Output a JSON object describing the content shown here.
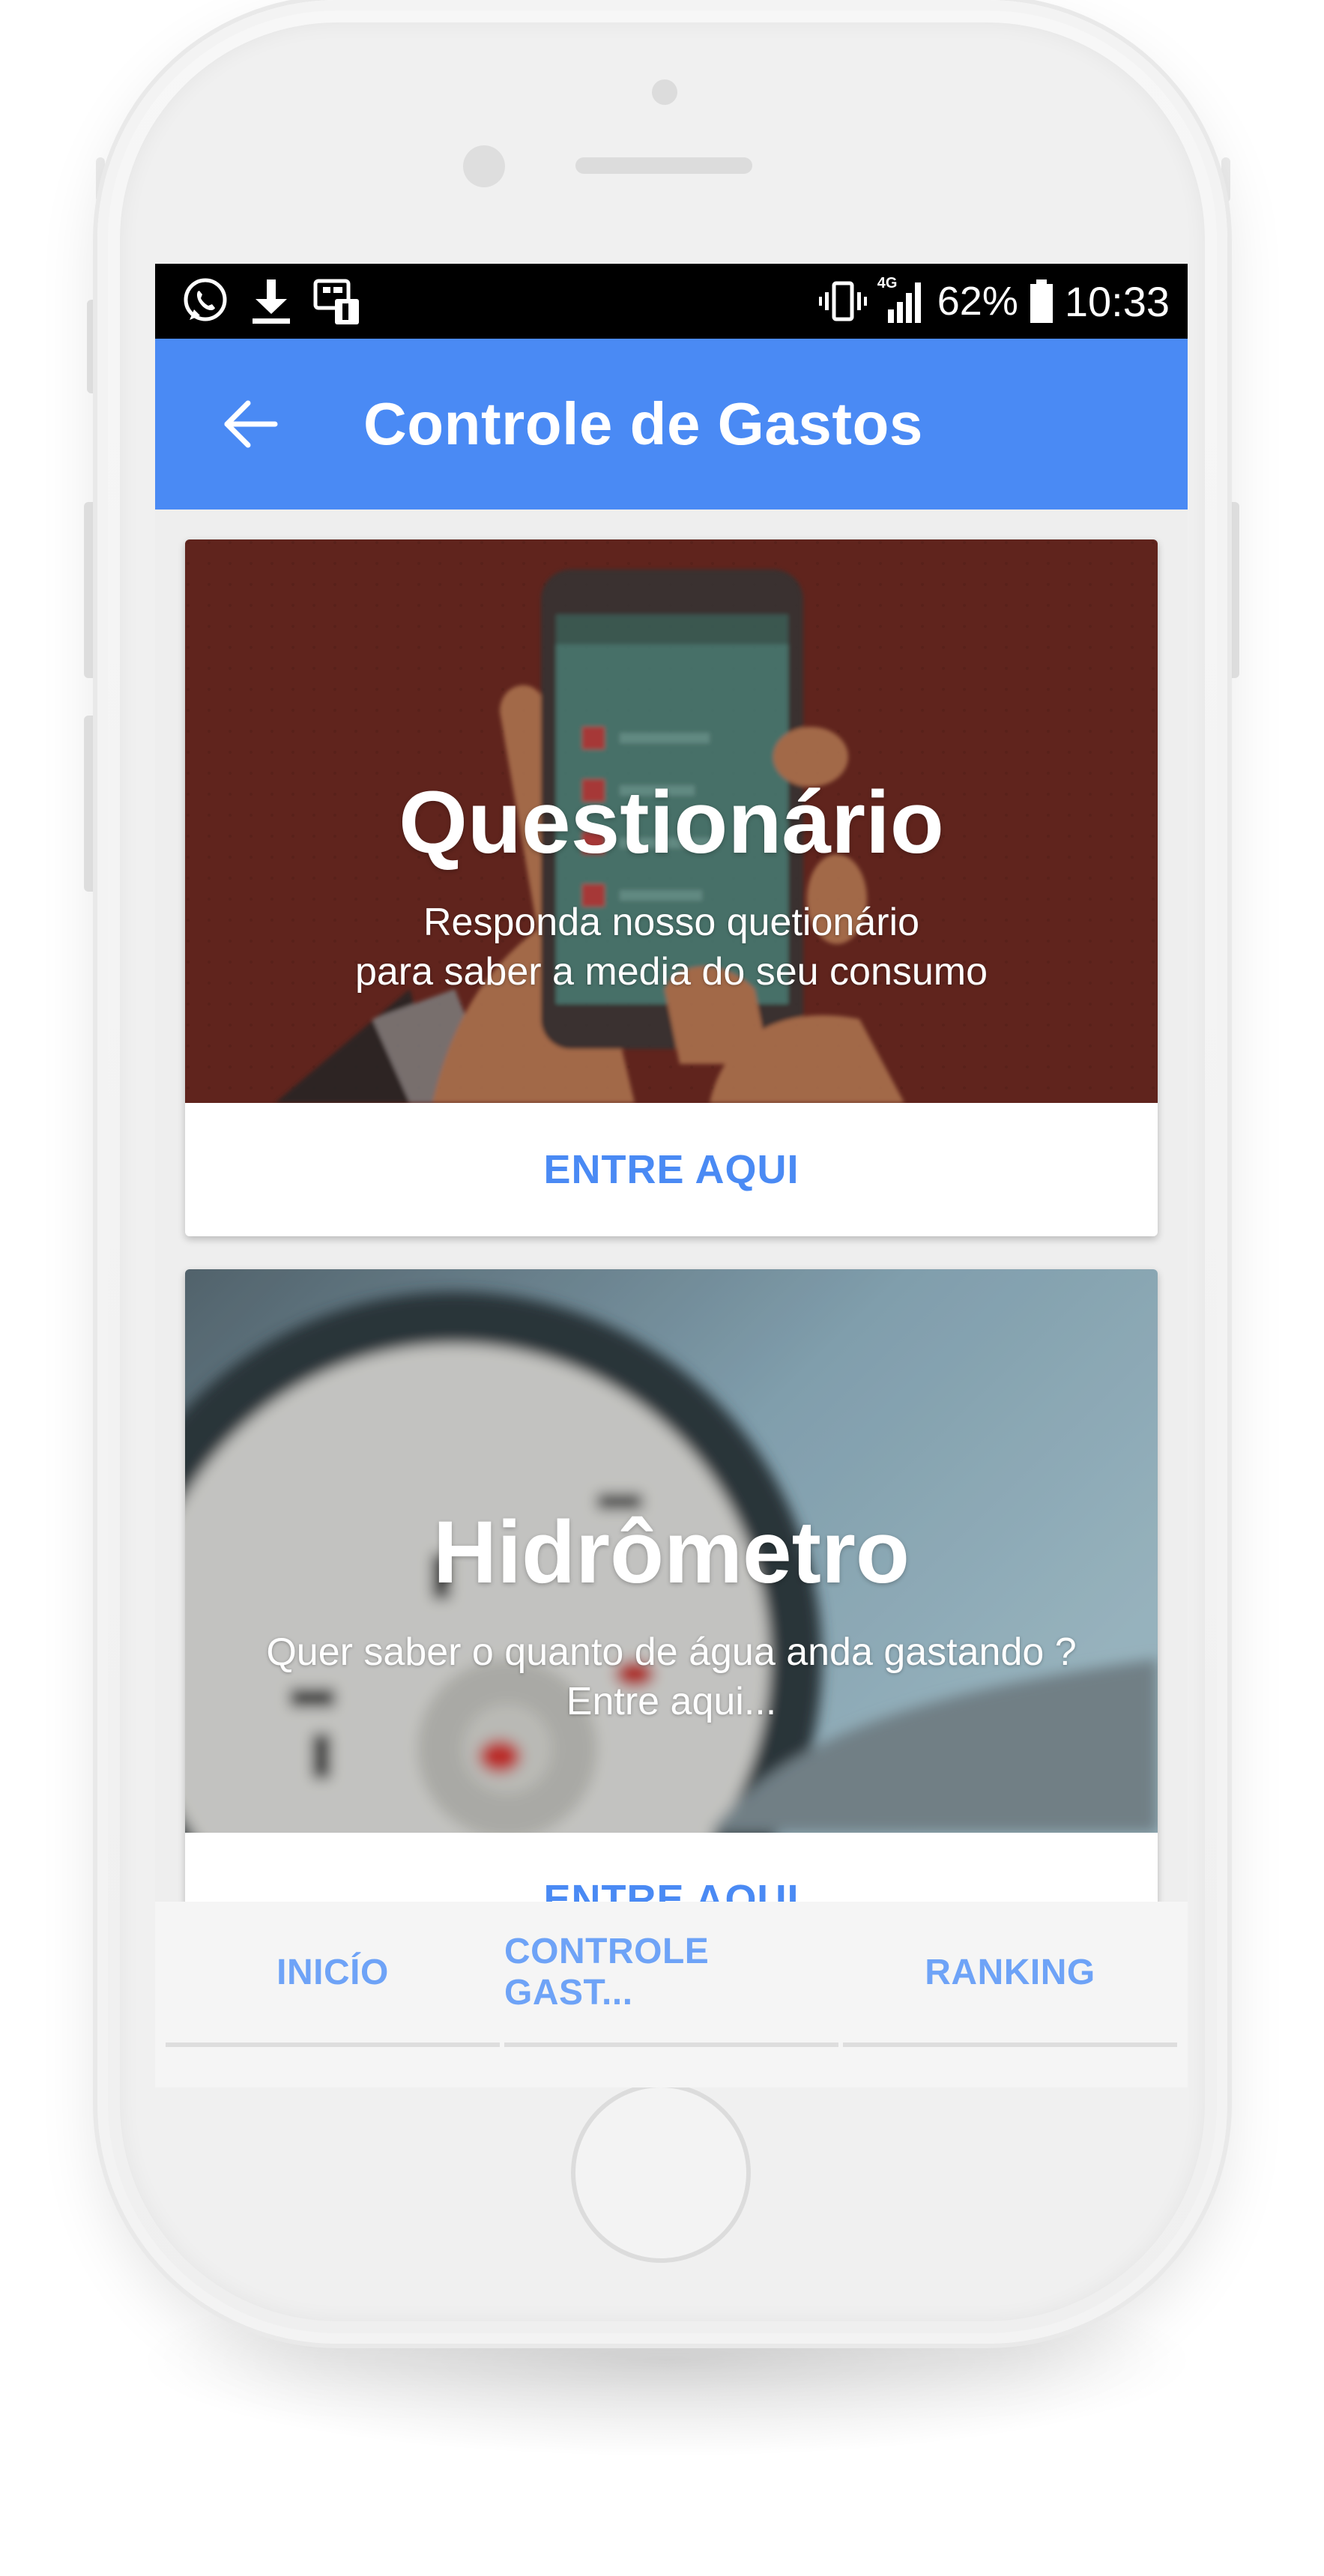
{
  "status_bar": {
    "icons_left": [
      "whatsapp-icon",
      "download-icon",
      "sim-notification-icon"
    ],
    "icons_right": [
      "vibrate-icon",
      "signal-4g-icon",
      "battery-icon"
    ],
    "network": "4G",
    "battery_percent": "62%",
    "time": "10:33"
  },
  "app_bar": {
    "back_icon": "back-arrow-icon",
    "title": "Controle de Gastos",
    "color": "#4a8af4"
  },
  "cards": [
    {
      "title": "Questionário",
      "subtitle_line1": "Responda nosso quetionário",
      "subtitle_line2": "para saber a media do seu consumo",
      "action": "ENTRE AQUI",
      "image_tint": "#6e2a22"
    },
    {
      "title": "Hidrômetro",
      "subtitle_line1": "Quer saber o quanto de água anda gastando ?",
      "subtitle_line2": "Entre aqui...",
      "action": "ENTRE AQUI",
      "image_tint": "#6e8a99"
    }
  ],
  "bottom_nav": {
    "tabs": [
      {
        "label": "INICÍO"
      },
      {
        "label": "CONTROLE GAST..."
      },
      {
        "label": "RANKING"
      }
    ],
    "color": "#6ea3f7"
  }
}
